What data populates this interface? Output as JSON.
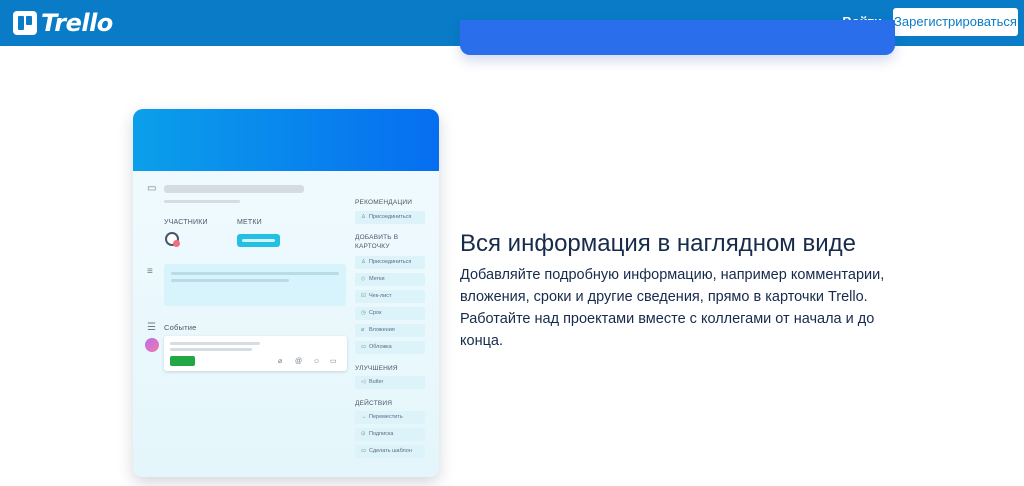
{
  "header": {
    "brand": "Trello",
    "login_label": "Войти",
    "signup_label": "Зарегистрироваться"
  },
  "mockup": {
    "members_label": "УЧАСТНИКИ",
    "labels_label": "МЕТКИ",
    "activity_label": "Событие",
    "sidebar": {
      "recommend_head": "РЕКОМЕНДАЦИИ",
      "recommend_items": [
        {
          "icon": "user-icon",
          "label": "Присоединиться"
        }
      ],
      "add_head": "ДОБАВИТЬ В КАРТОЧКУ",
      "add_items": [
        {
          "icon": "user-icon",
          "label": "Присоединиться"
        },
        {
          "icon": "tag-icon",
          "label": "Метки"
        },
        {
          "icon": "checklist-icon",
          "label": "Чек-лист"
        },
        {
          "icon": "clock-icon",
          "label": "Срок"
        },
        {
          "icon": "paperclip-icon",
          "label": "Вложения"
        },
        {
          "icon": "cover-icon",
          "label": "Обложка"
        }
      ],
      "powerups_head": "УЛУЧШЕНИЯ",
      "powerups_items": [
        {
          "icon": "butler-icon",
          "label": "Butler"
        }
      ],
      "actions_head": "ДЕЙСТВИЯ",
      "actions_items": [
        {
          "icon": "arrow-icon",
          "label": "Переместить"
        },
        {
          "icon": "copy-icon",
          "label": "Подписка"
        },
        {
          "icon": "template-icon",
          "label": "Сделать шаблон"
        }
      ]
    }
  },
  "feature": {
    "title": "Вся информация в наглядном виде",
    "description": "Добавляйте подробную информацию, например комментарии, вложения, сроки и другие сведения, прямо в карточки Trello. Работайте над проектами вместе с коллегами от начала и до конца."
  }
}
